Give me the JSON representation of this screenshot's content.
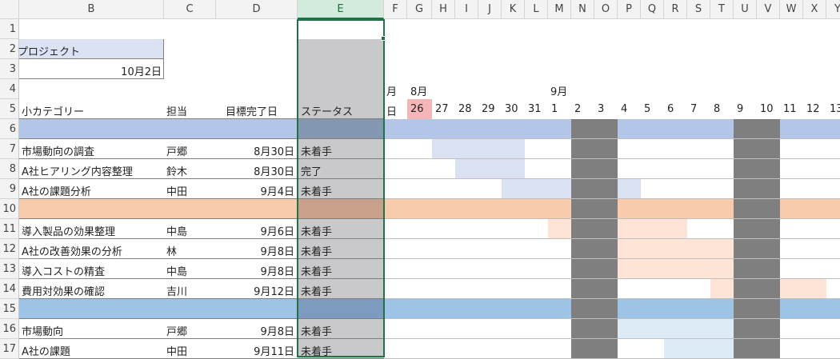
{
  "columns": [
    "B",
    "C",
    "D",
    "E",
    "F",
    "G",
    "H",
    "I",
    "J",
    "K",
    "L",
    "M",
    "N",
    "O",
    "P",
    "Q",
    "R",
    "S",
    "T",
    "U",
    "V",
    "W",
    "X",
    "Y"
  ],
  "selected_column": "E",
  "rows": [
    "1",
    "2",
    "3",
    "4",
    "5",
    "6",
    "7",
    "8",
    "9",
    "10",
    "11",
    "12",
    "13",
    "14",
    "15",
    "16",
    "17"
  ],
  "project_label": "プロジェクト",
  "date_value": "10月2日",
  "month_row": {
    "prev_month": "月",
    "aug": "8月",
    "sep": "9月"
  },
  "headers": {
    "subcategory": "小カテゴリー",
    "owner": "担当",
    "target_date": "目標完了日",
    "status": "ステータス",
    "day_label": "日"
  },
  "days": [
    "26",
    "27",
    "28",
    "29",
    "30",
    "31",
    "1",
    "2",
    "3",
    "4",
    "5",
    "6",
    "7",
    "8",
    "9",
    "10",
    "11",
    "12",
    "13"
  ],
  "tasks": [
    {
      "row": "7",
      "name": "市場動向の調査",
      "owner": "戸郷",
      "date": "8月30日",
      "status": "未着手"
    },
    {
      "row": "8",
      "name": "A社ヒアリング内容整理",
      "owner": "鈴木",
      "date": "8月30日",
      "status": "完了"
    },
    {
      "row": "9",
      "name": "A社の課題分析",
      "owner": "中田",
      "date": "9月4日",
      "status": "未着手"
    },
    {
      "row": "11",
      "name": "導入製品の効果整理",
      "owner": "中島",
      "date": "9月6日",
      "status": "未着手"
    },
    {
      "row": "12",
      "name": "A社の改善効果の分析",
      "owner": "林",
      "date": "9月8日",
      "status": "未着手"
    },
    {
      "row": "13",
      "name": "導入コストの精査",
      "owner": "中島",
      "date": "9月8日",
      "status": "未着手"
    },
    {
      "row": "14",
      "name": "費用対効果の確認",
      "owner": "吉川",
      "date": "9月12日",
      "status": "未着手"
    },
    {
      "row": "16",
      "name": "市場動向",
      "owner": "戸郷",
      "date": "9月8日",
      "status": "未着手"
    },
    {
      "row": "17",
      "name": "A社の課題",
      "owner": "中田",
      "date": "9月11日",
      "status": "未着手"
    }
  ],
  "colors": {
    "group_blue": "#b4c6e7",
    "group_orange": "#f8cbad",
    "group_blue2": "#9dc3e6",
    "status_column": "#c9c8ca",
    "weekend": "#7f7f7f",
    "today_highlight": "#f4b6b6",
    "bar_blue": "#d9e1f2",
    "bar_orange": "#fde4d6",
    "bar_lightblue": "#ddebf7",
    "label_fill": "#dbe2f4",
    "select_green": "#217346"
  }
}
